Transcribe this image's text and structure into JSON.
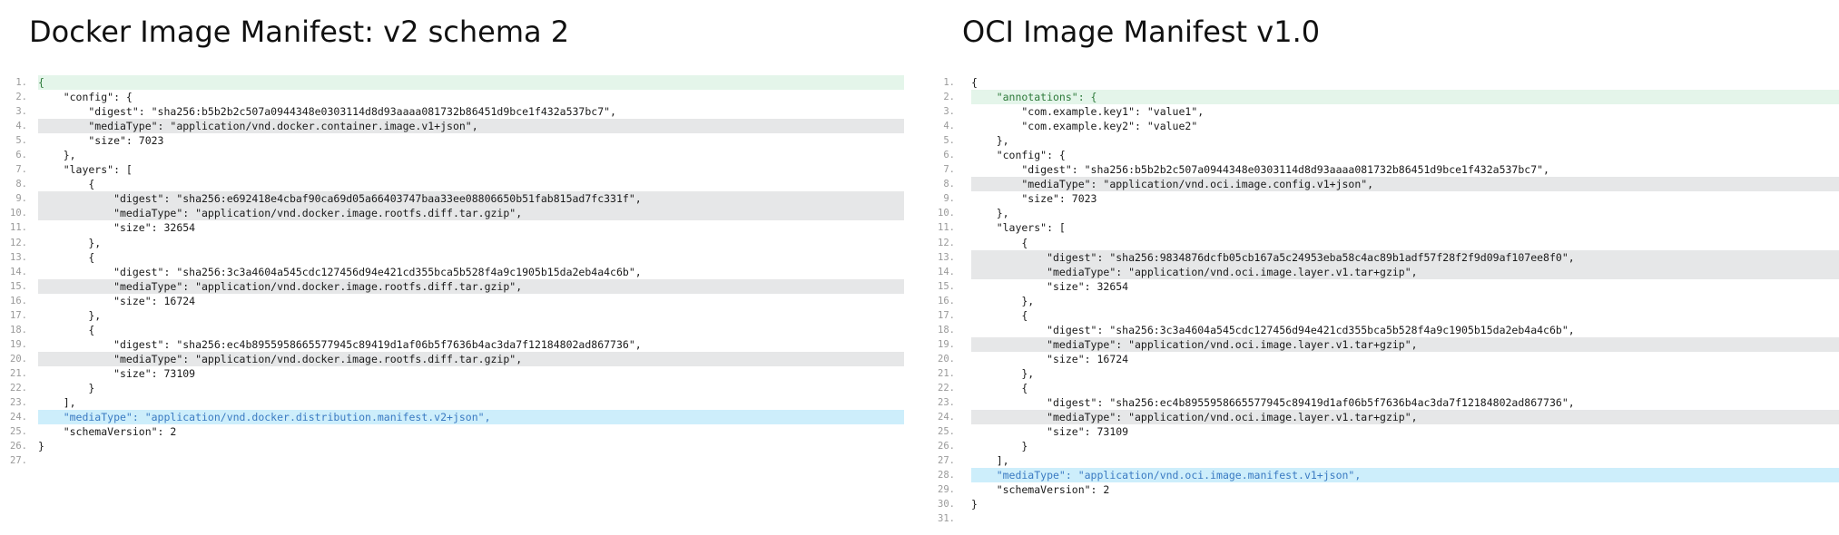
{
  "panels": [
    {
      "title": "Docker Image Manifest: v2 schema 2",
      "lines": [
        {
          "n": "1.",
          "text": "{",
          "hl": "green"
        },
        {
          "n": "2.",
          "text": "    \"config\": {",
          "hl": ""
        },
        {
          "n": "3.",
          "text": "        \"digest\": \"sha256:b5b2b2c507a0944348e0303114d8d93aaaa081732b86451d9bce1f432a537bc7\",",
          "hl": ""
        },
        {
          "n": "4.",
          "text": "        \"mediaType\": \"application/vnd.docker.container.image.v1+json\",",
          "hl": "grey"
        },
        {
          "n": "5.",
          "text": "        \"size\": 7023",
          "hl": ""
        },
        {
          "n": "6.",
          "text": "    },",
          "hl": ""
        },
        {
          "n": "7.",
          "text": "    \"layers\": [",
          "hl": ""
        },
        {
          "n": "8.",
          "text": "        {",
          "hl": ""
        },
        {
          "n": "9.",
          "text": "            \"digest\": \"sha256:e692418e4cbaf90ca69d05a66403747baa33ee08806650b51fab815ad7fc331f\",",
          "hl": "grey"
        },
        {
          "n": "10.",
          "text": "            \"mediaType\": \"application/vnd.docker.image.rootfs.diff.tar.gzip\",",
          "hl": "grey"
        },
        {
          "n": "11.",
          "text": "            \"size\": 32654",
          "hl": ""
        },
        {
          "n": "12.",
          "text": "        },",
          "hl": ""
        },
        {
          "n": "13.",
          "text": "        {",
          "hl": ""
        },
        {
          "n": "14.",
          "text": "            \"digest\": \"sha256:3c3a4604a545cdc127456d94e421cd355bca5b528f4a9c1905b15da2eb4a4c6b\",",
          "hl": ""
        },
        {
          "n": "15.",
          "text": "            \"mediaType\": \"application/vnd.docker.image.rootfs.diff.tar.gzip\",",
          "hl": "grey"
        },
        {
          "n": "16.",
          "text": "            \"size\": 16724",
          "hl": ""
        },
        {
          "n": "17.",
          "text": "        },",
          "hl": ""
        },
        {
          "n": "18.",
          "text": "        {",
          "hl": ""
        },
        {
          "n": "19.",
          "text": "            \"digest\": \"sha256:ec4b8955958665577945c89419d1af06b5f7636b4ac3da7f12184802ad867736\",",
          "hl": ""
        },
        {
          "n": "20.",
          "text": "            \"mediaType\": \"application/vnd.docker.image.rootfs.diff.tar.gzip\",",
          "hl": "grey"
        },
        {
          "n": "21.",
          "text": "            \"size\": 73109",
          "hl": ""
        },
        {
          "n": "22.",
          "text": "        }",
          "hl": ""
        },
        {
          "n": "23.",
          "text": "    ],",
          "hl": ""
        },
        {
          "n": "24.",
          "text": "    \"mediaType\": \"application/vnd.docker.distribution.manifest.v2+json\",",
          "hl": "blue"
        },
        {
          "n": "25.",
          "text": "    \"schemaVersion\": 2",
          "hl": ""
        },
        {
          "n": "26.",
          "text": "}",
          "hl": ""
        },
        {
          "n": "27.",
          "text": "",
          "hl": ""
        }
      ]
    },
    {
      "title": "OCI Image Manifest v1.0",
      "lines": [
        {
          "n": "1.",
          "text": "{",
          "hl": ""
        },
        {
          "n": "2.",
          "text": "    \"annotations\": {",
          "hl": "green"
        },
        {
          "n": "3.",
          "text": "        \"com.example.key1\": \"value1\",",
          "hl": ""
        },
        {
          "n": "4.",
          "text": "        \"com.example.key2\": \"value2\"",
          "hl": ""
        },
        {
          "n": "5.",
          "text": "    },",
          "hl": ""
        },
        {
          "n": "6.",
          "text": "    \"config\": {",
          "hl": ""
        },
        {
          "n": "7.",
          "text": "        \"digest\": \"sha256:b5b2b2c507a0944348e0303114d8d93aaaa081732b86451d9bce1f432a537bc7\",",
          "hl": ""
        },
        {
          "n": "8.",
          "text": "        \"mediaType\": \"application/vnd.oci.image.config.v1+json\",",
          "hl": "grey"
        },
        {
          "n": "9.",
          "text": "        \"size\": 7023",
          "hl": ""
        },
        {
          "n": "10.",
          "text": "    },",
          "hl": ""
        },
        {
          "n": "11.",
          "text": "    \"layers\": [",
          "hl": ""
        },
        {
          "n": "12.",
          "text": "        {",
          "hl": ""
        },
        {
          "n": "13.",
          "text": "            \"digest\": \"sha256:9834876dcfb05cb167a5c24953eba58c4ac89b1adf57f28f2f9d09af107ee8f0\",",
          "hl": "grey"
        },
        {
          "n": "14.",
          "text": "            \"mediaType\": \"application/vnd.oci.image.layer.v1.tar+gzip\",",
          "hl": "grey"
        },
        {
          "n": "15.",
          "text": "            \"size\": 32654",
          "hl": ""
        },
        {
          "n": "16.",
          "text": "        },",
          "hl": ""
        },
        {
          "n": "17.",
          "text": "        {",
          "hl": ""
        },
        {
          "n": "18.",
          "text": "            \"digest\": \"sha256:3c3a4604a545cdc127456d94e421cd355bca5b528f4a9c1905b15da2eb4a4c6b\",",
          "hl": ""
        },
        {
          "n": "19.",
          "text": "            \"mediaType\": \"application/vnd.oci.image.layer.v1.tar+gzip\",",
          "hl": "grey"
        },
        {
          "n": "20.",
          "text": "            \"size\": 16724",
          "hl": ""
        },
        {
          "n": "21.",
          "text": "        },",
          "hl": ""
        },
        {
          "n": "22.",
          "text": "        {",
          "hl": ""
        },
        {
          "n": "23.",
          "text": "            \"digest\": \"sha256:ec4b8955958665577945c89419d1af06b5f7636b4ac3da7f12184802ad867736\",",
          "hl": ""
        },
        {
          "n": "24.",
          "text": "            \"mediaType\": \"application/vnd.oci.image.layer.v1.tar+gzip\",",
          "hl": "grey"
        },
        {
          "n": "25.",
          "text": "            \"size\": 73109",
          "hl": ""
        },
        {
          "n": "26.",
          "text": "        }",
          "hl": ""
        },
        {
          "n": "27.",
          "text": "    ],",
          "hl": ""
        },
        {
          "n": "28.",
          "text": "    \"mediaType\": \"application/vnd.oci.image.manifest.v1+json\",",
          "hl": "blue"
        },
        {
          "n": "29.",
          "text": "    \"schemaVersion\": 2",
          "hl": ""
        },
        {
          "n": "30.",
          "text": "}",
          "hl": ""
        },
        {
          "n": "31.",
          "text": "",
          "hl": ""
        }
      ]
    }
  ],
  "colors": {
    "highlight_grey": "#e6e7e8",
    "highlight_green": "#e4f5ea",
    "highlight_blue": "#cdeefb",
    "line_number": "#9a9a9a"
  }
}
